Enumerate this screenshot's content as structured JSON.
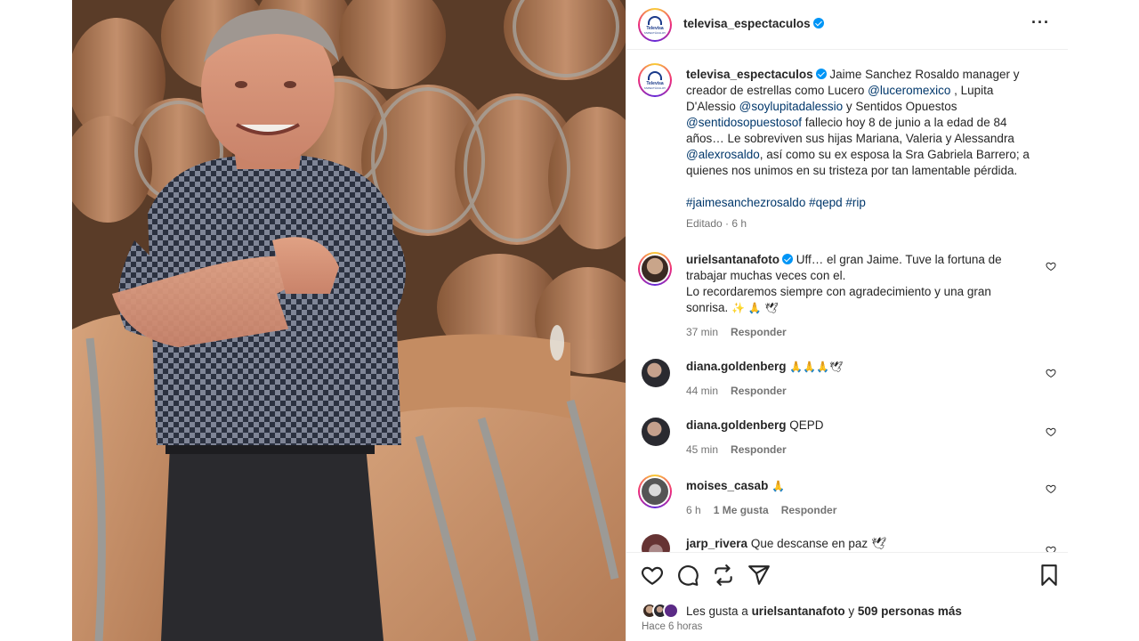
{
  "post": {
    "account": "televisa_espectaculos",
    "caption": {
      "part1": " Jaime Sanchez Rosaldo manager y creador de estrellas como Lucero ",
      "mention1": "@luceromexico",
      "part2": " , Lupita D'Alessio ",
      "mention2": "@soylupitadalessio",
      "part3": " y Sentidos Opuestos ",
      "mention3": "@sentidosopuestosof",
      "part4": " fallecio hoy 8 de junio a la edad de 84 años… Le sobreviven sus hijas Mariana, Valeria y Alessandra ",
      "mention4": "@alexrosaldo",
      "part5": ", así como su ex esposa la Sra Gabriela Barrero; a quienes nos unimos en su tristeza por tan lamentable pérdida.",
      "hashtags": "#jaimesanchezrosaldo #qepd #rip",
      "edited": "Editado · 6 h"
    },
    "logo": {
      "word": "Televisa",
      "sub": "ESPECTÁCULOS"
    }
  },
  "comments": [
    {
      "user": "urielsantanafoto",
      "verified": true,
      "text_line1": " Uff… el gran Jaime. Tuve la fortuna de trabajar muchas veces con el.",
      "text_line2": "Lo recordaremos siempre con agradecimiento y una gran sonrisa.",
      "emoji": "✨ 🙏 🕊",
      "time": "37 min",
      "reply": "Responder"
    },
    {
      "user": "diana.goldenberg",
      "text": " 🙏🙏🙏🕊",
      "time": "44 min",
      "reply": "Responder"
    },
    {
      "user": "diana.goldenberg",
      "text": " QEPD",
      "time": "45 min",
      "reply": "Responder"
    },
    {
      "user": "moises_casab",
      "text": " 🙏",
      "time": "6 h",
      "likes": "1 Me gusta",
      "reply": "Responder"
    },
    {
      "user": "jarp_rivera",
      "text": " Que descanse en paz 🕊"
    }
  ],
  "footer": {
    "likes_prefix": "Les gusta a ",
    "likes_user": "urielsantanafoto",
    "likes_mid": " y ",
    "likes_count": "509 personas más",
    "posted": "Hace 6 horas"
  },
  "colors": {
    "link": "#00376b",
    "verified": "#0095f6",
    "muted": "#737373"
  }
}
